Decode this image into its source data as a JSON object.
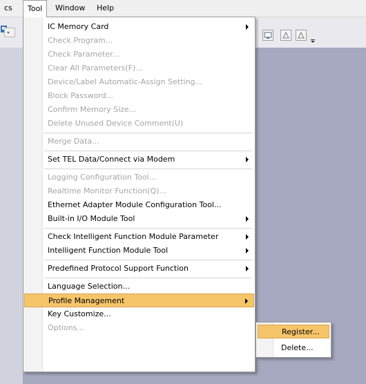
{
  "menubar": {
    "items": [
      {
        "label": "cs"
      },
      {
        "label": "Tool"
      },
      {
        "label": "Window"
      },
      {
        "label": "Help"
      }
    ]
  },
  "tool_menu": {
    "items": [
      {
        "label": "IC Memory Card",
        "state": "enabled",
        "submenu": true
      },
      {
        "label": "Check Program...",
        "state": "disabled"
      },
      {
        "label": "Check Parameter...",
        "state": "disabled"
      },
      {
        "label": "Clear All Parameters(F)...",
        "state": "disabled"
      },
      {
        "label": "Device/Label Automatic-Assign Setting...",
        "state": "disabled"
      },
      {
        "label": "Block Password...",
        "state": "disabled"
      },
      {
        "label": "Confirm Memory Size...",
        "state": "disabled"
      },
      {
        "label": "Delete Unused Device Comment(U)",
        "state": "disabled"
      },
      {
        "label": "Merge Data...",
        "state": "disabled"
      },
      {
        "label": "Set TEL Data/Connect via Modem",
        "state": "enabled",
        "submenu": true
      },
      {
        "label": "Logging Configuration Tool...",
        "state": "disabled"
      },
      {
        "label": "Realtime Monitor Function(Q)...",
        "state": "disabled"
      },
      {
        "label": "Ethernet Adapter Module Configuration Tool...",
        "state": "enabled"
      },
      {
        "label": "Built-in I/O Module Tool",
        "state": "enabled",
        "submenu": true
      },
      {
        "label": "Check Intelligent Function Module Parameter",
        "state": "enabled",
        "submenu": true
      },
      {
        "label": "Intelligent Function Module Tool",
        "state": "enabled",
        "submenu": true
      },
      {
        "label": "Predefined Protocol Support Function",
        "state": "enabled",
        "submenu": true
      },
      {
        "label": "Language Selection...",
        "state": "enabled"
      },
      {
        "label": "Profile Management",
        "state": "highlighted",
        "submenu": true
      },
      {
        "label": "Key Customize...",
        "state": "enabled"
      },
      {
        "label": "Options...",
        "state": "disabled"
      }
    ]
  },
  "profile_submenu": {
    "items": [
      {
        "label": "Register...",
        "state": "highlighted"
      },
      {
        "label": "Delete...",
        "state": "enabled"
      }
    ]
  },
  "colors": {
    "highlight": "#f6c56a",
    "disabled_text": "#a5a5a5",
    "background": "#a5a8be"
  }
}
